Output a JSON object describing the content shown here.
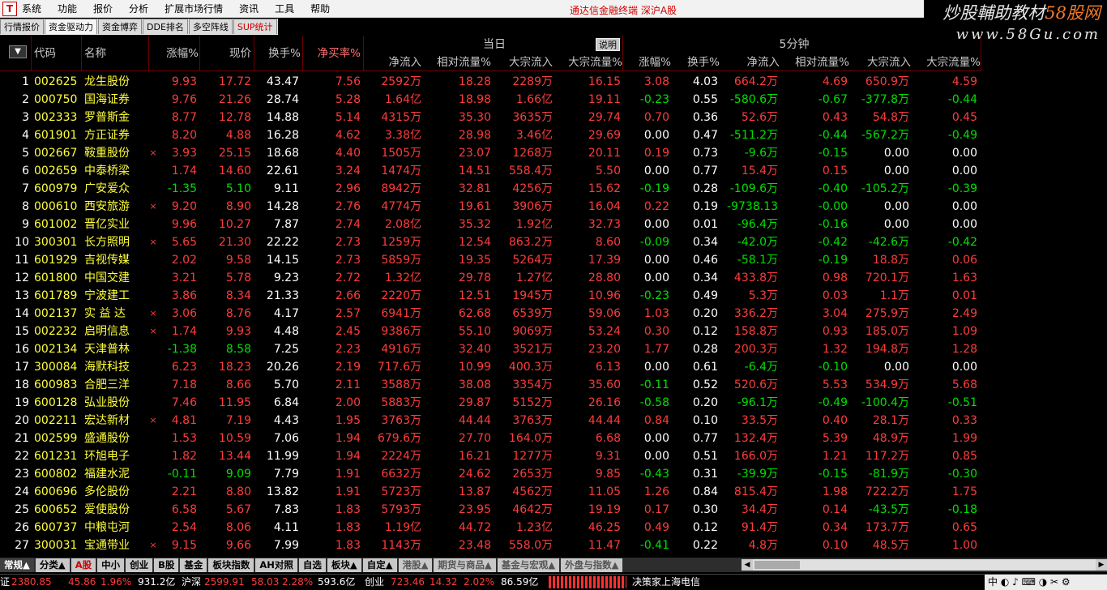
{
  "menu": {
    "logo": "T",
    "items": [
      "系统",
      "功能",
      "报价",
      "分析",
      "扩展市场行情",
      "资讯",
      "工具",
      "帮助"
    ],
    "app_title": "通达信金融终端    深沪A股"
  },
  "watermark": {
    "line1a": "炒股輔助教材",
    "line1b": "58股网",
    "line2": "www.58Gu.com"
  },
  "tabs": [
    "行情报价",
    "资金驱动力",
    "资金博弈",
    "DDE排名",
    "多空阵线",
    "SUP统计"
  ],
  "header": {
    "sort_arrow": "▼",
    "code": "代码",
    "name": "名称",
    "change_pct": "涨幅%",
    "price": "现价",
    "turnover": "换手%",
    "net_buy_rate": "净买率%",
    "group_today": "当日",
    "explain_button": "说明",
    "group_5min": "5分钟",
    "today_cols": [
      "净流入",
      "相对流量%",
      "大宗流入",
      "大宗流量%"
    ],
    "min5_cols": [
      "涨幅%",
      "换手%",
      "净流入",
      "相对流量%",
      "大宗流入",
      "大宗流量%"
    ]
  },
  "rows": [
    [
      "1",
      "002625",
      "龙生股份",
      "",
      "9.93",
      "17.72",
      "43.47",
      "7.56",
      "2592万",
      "18.28",
      "2289万",
      "16.15",
      "3.08",
      "4.03",
      "664.2万",
      "4.69",
      "650.9万",
      "4.59"
    ],
    [
      "2",
      "000750",
      "国海证券",
      "",
      "9.76",
      "21.26",
      "28.74",
      "5.28",
      "1.64亿",
      "18.98",
      "1.66亿",
      "19.11",
      "-0.23",
      "0.55",
      "-580.6万",
      "-0.67",
      "-377.8万",
      "-0.44"
    ],
    [
      "3",
      "002333",
      "罗普斯金",
      "",
      "8.77",
      "12.78",
      "14.88",
      "5.14",
      "4315万",
      "35.30",
      "3635万",
      "29.74",
      "0.70",
      "0.36",
      "52.6万",
      "0.43",
      "54.8万",
      "0.45"
    ],
    [
      "4",
      "601901",
      "方正证券",
      "",
      "8.20",
      "4.88",
      "16.28",
      "4.62",
      "3.38亿",
      "28.98",
      "3.46亿",
      "29.69",
      "0.00",
      "0.47",
      "-511.2万",
      "-0.44",
      "-567.2万",
      "-0.49"
    ],
    [
      "5",
      "002667",
      "鞍重股份",
      "×",
      "3.93",
      "25.15",
      "18.68",
      "4.40",
      "1505万",
      "23.07",
      "1268万",
      "20.11",
      "0.19",
      "0.73",
      "-9.6万",
      "-0.15",
      "0.00",
      "0.00"
    ],
    [
      "6",
      "002659",
      "中泰桥梁",
      "",
      "1.74",
      "14.60",
      "22.61",
      "3.24",
      "1474万",
      "14.51",
      "558.4万",
      "5.50",
      "0.00",
      "0.77",
      "15.4万",
      "0.15",
      "0.00",
      "0.00"
    ],
    [
      "7",
      "600979",
      "广安爱众",
      "",
      "-1.35",
      "5.10",
      "9.11",
      "2.96",
      "8942万",
      "32.81",
      "4256万",
      "15.62",
      "-0.19",
      "0.28",
      "-109.6万",
      "-0.40",
      "-105.2万",
      "-0.39"
    ],
    [
      "8",
      "000610",
      "西安旅游",
      "×",
      "9.20",
      "8.90",
      "14.28",
      "2.76",
      "4774万",
      "19.61",
      "3906万",
      "16.04",
      "0.22",
      "0.19",
      "-9738.13",
      "-0.00",
      "0.00",
      "0.00"
    ],
    [
      "9",
      "601002",
      "晋亿实业",
      "",
      "9.96",
      "10.27",
      "7.87",
      "2.74",
      "2.08亿",
      "35.32",
      "1.92亿",
      "32.73",
      "0.00",
      "0.01",
      "-96.4万",
      "-0.16",
      "0.00",
      "0.00"
    ],
    [
      "10",
      "300301",
      "长方照明",
      "×",
      "5.65",
      "21.30",
      "22.22",
      "2.73",
      "1259万",
      "12.54",
      "863.2万",
      "8.60",
      "-0.09",
      "0.34",
      "-42.0万",
      "-0.42",
      "-42.6万",
      "-0.42"
    ],
    [
      "11",
      "601929",
      "吉视传媒",
      "",
      "2.02",
      "9.58",
      "14.15",
      "2.73",
      "5859万",
      "19.35",
      "5264万",
      "17.39",
      "0.00",
      "0.46",
      "-58.1万",
      "-0.19",
      "18.8万",
      "0.06"
    ],
    [
      "12",
      "601800",
      "中国交建",
      "",
      "3.21",
      "5.78",
      "9.23",
      "2.72",
      "1.32亿",
      "29.78",
      "1.27亿",
      "28.80",
      "0.00",
      "0.34",
      "433.8万",
      "0.98",
      "720.1万",
      "1.63"
    ],
    [
      "13",
      "601789",
      "宁波建工",
      "",
      "3.86",
      "8.34",
      "21.33",
      "2.66",
      "2220万",
      "12.51",
      "1945万",
      "10.96",
      "-0.23",
      "0.49",
      "5.3万",
      "0.03",
      "1.1万",
      "0.01"
    ],
    [
      "14",
      "002137",
      "实 益 达",
      "×",
      "3.06",
      "8.76",
      "4.17",
      "2.57",
      "6941万",
      "62.68",
      "6539万",
      "59.06",
      "1.03",
      "0.20",
      "336.2万",
      "3.04",
      "275.9万",
      "2.49"
    ],
    [
      "15",
      "002232",
      "启明信息",
      "×",
      "1.74",
      "9.93",
      "4.48",
      "2.45",
      "9386万",
      "55.10",
      "9069万",
      "53.24",
      "0.30",
      "0.12",
      "158.8万",
      "0.93",
      "185.0万",
      "1.09"
    ],
    [
      "16",
      "002134",
      "天津普林",
      "",
      "-1.38",
      "8.58",
      "7.25",
      "2.23",
      "4916万",
      "32.40",
      "3521万",
      "23.20",
      "1.77",
      "0.28",
      "200.3万",
      "1.32",
      "194.8万",
      "1.28"
    ],
    [
      "17",
      "300084",
      "海默科技",
      "",
      "6.23",
      "18.23",
      "20.26",
      "2.19",
      "717.6万",
      "10.99",
      "400.3万",
      "6.13",
      "0.00",
      "0.61",
      "-6.4万",
      "-0.10",
      "0.00",
      "0.00"
    ],
    [
      "18",
      "600983",
      "合肥三洋",
      "",
      "7.18",
      "8.66",
      "5.70",
      "2.11",
      "3588万",
      "38.08",
      "3354万",
      "35.60",
      "-0.11",
      "0.52",
      "520.6万",
      "5.53",
      "534.9万",
      "5.68"
    ],
    [
      "19",
      "600128",
      "弘业股份",
      "",
      "7.46",
      "11.95",
      "6.84",
      "2.00",
      "5883万",
      "29.87",
      "5152万",
      "26.16",
      "-0.58",
      "0.20",
      "-96.1万",
      "-0.49",
      "-100.4万",
      "-0.51"
    ],
    [
      "20",
      "002211",
      "宏达新材",
      "×",
      "4.81",
      "7.19",
      "4.43",
      "1.95",
      "3763万",
      "44.44",
      "3763万",
      "44.44",
      "0.84",
      "0.10",
      "33.5万",
      "0.40",
      "28.1万",
      "0.33"
    ],
    [
      "21",
      "002599",
      "盛通股份",
      "",
      "1.53",
      "10.59",
      "7.06",
      "1.94",
      "679.6万",
      "27.70",
      "164.0万",
      "6.68",
      "0.00",
      "0.77",
      "132.4万",
      "5.39",
      "48.9万",
      "1.99"
    ],
    [
      "22",
      "601231",
      "环旭电子",
      "",
      "1.82",
      "13.44",
      "11.99",
      "1.94",
      "2224万",
      "16.21",
      "1277万",
      "9.31",
      "0.00",
      "0.51",
      "166.0万",
      "1.21",
      "117.2万",
      "0.85"
    ],
    [
      "23",
      "600802",
      "福建水泥",
      "",
      "-0.11",
      "9.09",
      "7.79",
      "1.91",
      "6632万",
      "24.62",
      "2653万",
      "9.85",
      "-0.43",
      "0.31",
      "-39.9万",
      "-0.15",
      "-81.9万",
      "-0.30"
    ],
    [
      "24",
      "600696",
      "多伦股份",
      "",
      "2.21",
      "8.80",
      "13.82",
      "1.91",
      "5723万",
      "13.87",
      "4562万",
      "11.05",
      "1.26",
      "0.84",
      "815.4万",
      "1.98",
      "722.2万",
      "1.75"
    ],
    [
      "25",
      "600652",
      "爱使股份",
      "",
      "6.58",
      "5.67",
      "7.83",
      "1.83",
      "5793万",
      "23.95",
      "4642万",
      "19.19",
      "0.17",
      "0.30",
      "34.4万",
      "0.14",
      "-43.5万",
      "-0.18"
    ],
    [
      "26",
      "600737",
      "中粮屯河",
      "",
      "2.54",
      "8.06",
      "4.11",
      "1.83",
      "1.19亿",
      "44.72",
      "1.23亿",
      "46.25",
      "0.49",
      "0.12",
      "91.4万",
      "0.34",
      "173.7万",
      "0.65"
    ],
    [
      "27",
      "300031",
      "宝通带业",
      "×",
      "9.15",
      "9.66",
      "7.99",
      "1.83",
      "1143万",
      "23.48",
      "558.0万",
      "11.47",
      "-0.41",
      "0.22",
      "4.8万",
      "0.10",
      "48.5万",
      "1.00"
    ]
  ],
  "bottom_tabs": [
    "常规▲",
    "分类▲",
    "A股",
    "中小",
    "创业",
    "B股",
    "基金",
    "板块指数",
    "AH对照",
    "自选",
    "板块▲",
    "自定▲",
    "港股▲",
    "期货与商品▲",
    "基金与宏观▲",
    "外盘与指数▲"
  ],
  "status": {
    "sh_label": "证",
    "sh_val": "2380.85",
    "sh_chg": "45.86",
    "sh_pct": "1.96%",
    "sh_amt": "931.2亿",
    "sz_label": "沪深",
    "sz_val": "2599.91",
    "sz_chg": "58.03",
    "sz_pct": "2.28%",
    "sz_amt": "593.6亿",
    "cy_label": "创业",
    "cy_val": "723.46",
    "cy_chg": "14.32",
    "cy_pct": "2.02%",
    "cy_amt": "86.59亿",
    "news": "决策家上海电信",
    "tray": "中 ◐ ♪ ⌨ ◑ ✂ ⚙"
  },
  "colors": {
    "up": "#ff3c3c",
    "down": "#00e000",
    "flat": "#ffffff",
    "code": "#ffff3a"
  }
}
